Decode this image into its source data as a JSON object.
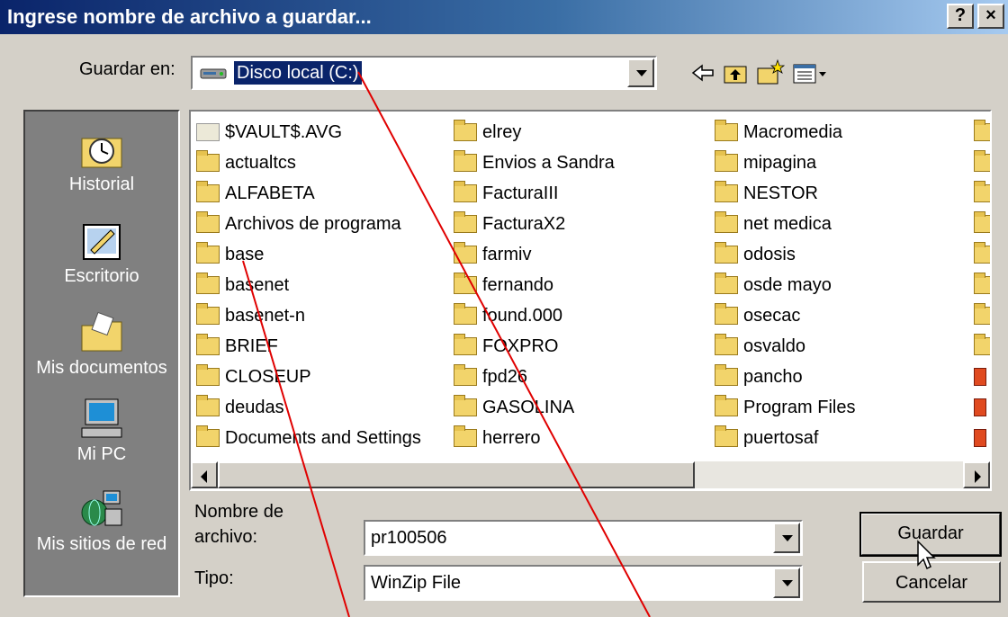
{
  "window": {
    "title": "Ingrese nombre de archivo a guardar...",
    "help_label": "?",
    "close_label": "×"
  },
  "save_in": {
    "label": "Guardar en:",
    "value": "Disco local (C:)"
  },
  "toolbar": {
    "back_icon": "back-arrow-icon",
    "up_icon": "up-folder-icon",
    "new_icon": "new-folder-icon",
    "view_icon": "view-menu-icon"
  },
  "places": [
    {
      "label": "Historial",
      "icon": "history-icon"
    },
    {
      "label": "Escritorio",
      "icon": "desktop-icon"
    },
    {
      "label": "Mis documentos",
      "icon": "my-documents-icon"
    },
    {
      "label": "Mi PC",
      "icon": "my-computer-icon"
    },
    {
      "label": "Mis sitios de red",
      "icon": "network-places-icon"
    }
  ],
  "files": {
    "col1": [
      "$VAULT$.AVG",
      "actualtcs",
      "ALFABETA",
      "Archivos de programa",
      "base",
      "basenet",
      "basenet-n",
      "BRIEF",
      "CLOSEUP",
      "deudas",
      "Documents and Settings"
    ],
    "col2": [
      "elrey",
      "Envios a Sandra",
      "FacturaIII",
      "FacturaX2",
      "farmiv",
      "fernando",
      "found.000",
      "FOXPRO",
      "fpd26",
      "GASOLINA",
      "herrero"
    ],
    "col3": [
      "Macromedia",
      "mipagina",
      "NESTOR",
      "net medica",
      "odosis",
      "osde mayo",
      "osecac",
      "osvaldo",
      "pancho",
      "Program Files",
      "puertosaf"
    ]
  },
  "filename": {
    "label_line1": "Nombre de",
    "label_line2": "archivo:",
    "value": "pr100506"
  },
  "filetype": {
    "label": "Tipo:",
    "value": "WinZip File"
  },
  "buttons": {
    "save": "Guardar",
    "cancel": "Cancelar"
  }
}
